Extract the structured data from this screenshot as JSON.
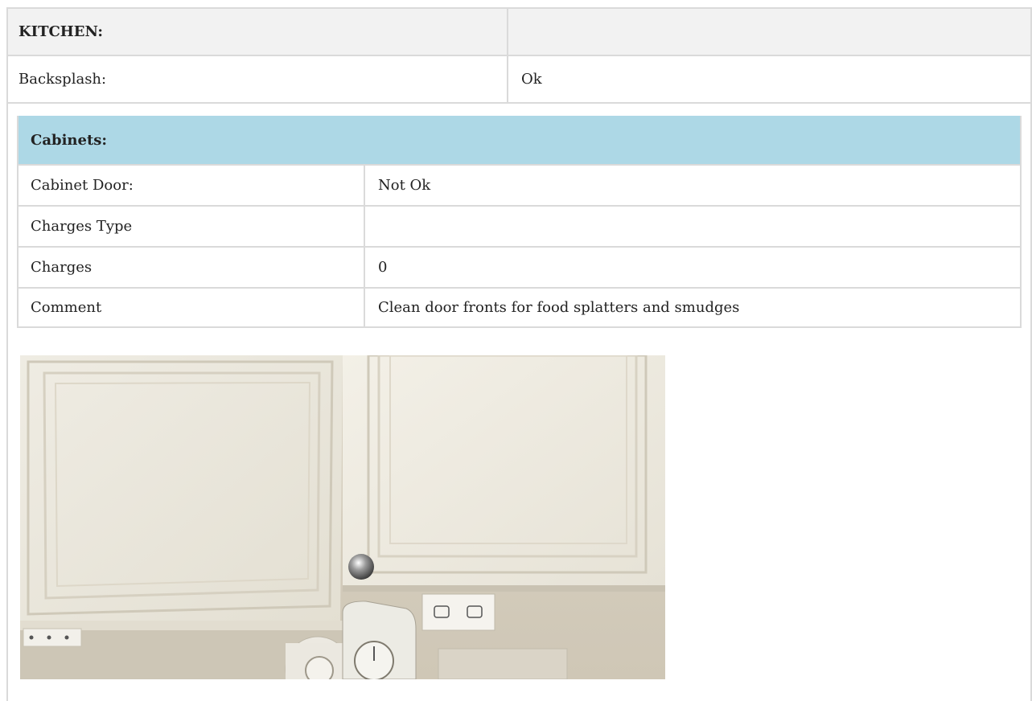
{
  "kitchen": {
    "title": "KITCHEN:",
    "title_value": "",
    "backsplash_label": "Backsplash:",
    "backsplash_value": "Ok"
  },
  "cabinets": {
    "header": "Cabinets:",
    "header_value": "",
    "rows": [
      {
        "label": "Cabinet Door:",
        "value": "Not Ok"
      },
      {
        "label": "Charges Type",
        "value": ""
      },
      {
        "label": "Charges",
        "value": "0"
      },
      {
        "label": "Comment",
        "value": "Clean door fronts for food splatters and smudges"
      }
    ]
  },
  "colors": {
    "header_bg": "#f2f2f2",
    "cabinets_header_bg": "#add8e6",
    "border": "#dadada"
  }
}
